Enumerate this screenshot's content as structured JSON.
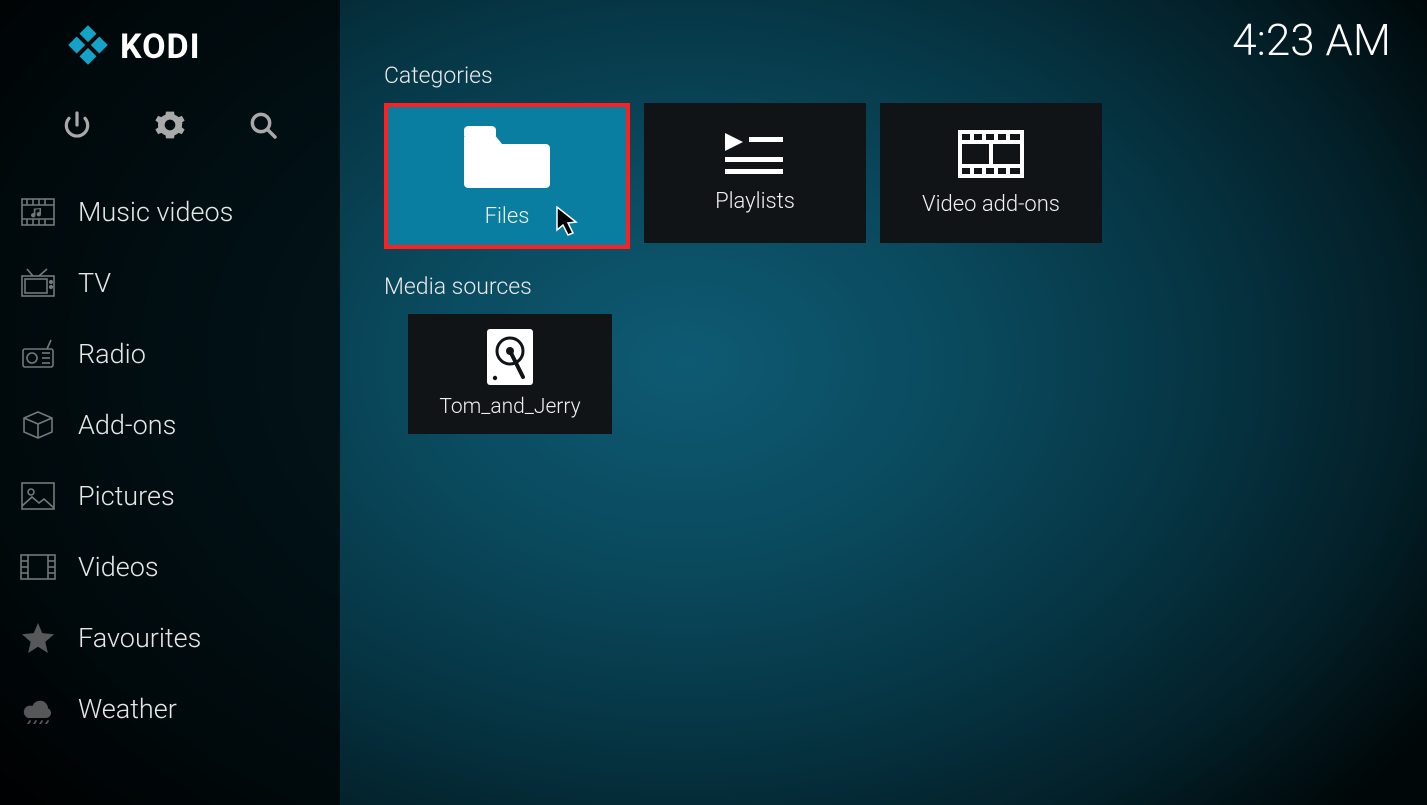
{
  "header": {
    "app_name": "KODI",
    "clock": "4:23 AM"
  },
  "sidebar": {
    "items": [
      {
        "id": "music-videos",
        "label": "Music videos"
      },
      {
        "id": "tv",
        "label": "TV"
      },
      {
        "id": "radio",
        "label": "Radio"
      },
      {
        "id": "addons",
        "label": "Add-ons"
      },
      {
        "id": "pictures",
        "label": "Pictures"
      },
      {
        "id": "videos",
        "label": "Videos"
      },
      {
        "id": "favourites",
        "label": "Favourites"
      },
      {
        "id": "weather",
        "label": "Weather"
      }
    ]
  },
  "sections": {
    "categories_title": "Categories",
    "media_sources_title": "Media sources"
  },
  "categories": [
    {
      "id": "files",
      "label": "Files",
      "selected": true
    },
    {
      "id": "playlists",
      "label": "Playlists",
      "selected": false
    },
    {
      "id": "video-addons",
      "label": "Video add-ons",
      "selected": false
    }
  ],
  "media_sources": [
    {
      "id": "tom-and-jerry",
      "label": "Tom_and_Jerry"
    }
  ]
}
